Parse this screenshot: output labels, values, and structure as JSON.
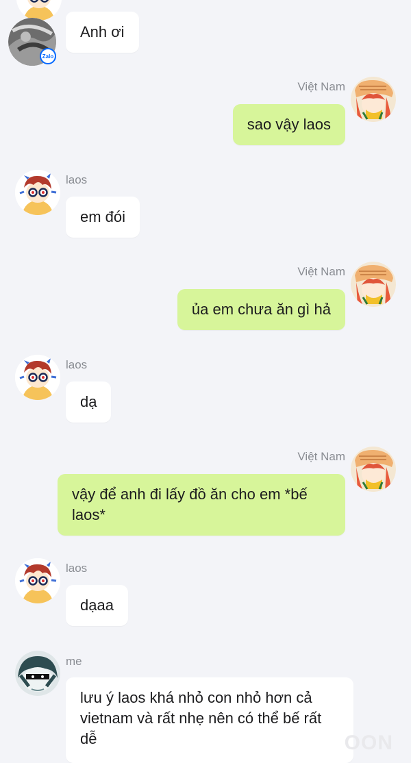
{
  "brand": {
    "badge_text": "Zalo",
    "accent": "#0068ff"
  },
  "colors": {
    "incoming_bubble": "#ffffff",
    "outgoing_bubble": "#d7f59a",
    "background": "#f3f4f8"
  },
  "messages": [
    {
      "sender": "",
      "text": "Anh ơi",
      "direction": "incoming"
    },
    {
      "sender": "Việt Nam",
      "text": "sao vậy laos",
      "direction": "outgoing"
    },
    {
      "sender": "laos",
      "text": "em đói",
      "direction": "incoming"
    },
    {
      "sender": "Việt Nam",
      "text": "ủa em chưa ăn gì hả",
      "direction": "outgoing"
    },
    {
      "sender": "laos",
      "text": "dạ",
      "direction": "incoming"
    },
    {
      "sender": "Việt Nam",
      "text": "vậy để anh đi lấy đồ ăn cho em *bế laos*",
      "direction": "outgoing"
    },
    {
      "sender": "laos",
      "text": "dạaa",
      "direction": "incoming"
    },
    {
      "sender": "me",
      "text": "lưu ý laos khá nhỏ con nhỏ hơn cả vietnam và rất nhẹ nên có thể bế rất dễ",
      "direction": "incoming"
    }
  ],
  "watermark": "OON"
}
